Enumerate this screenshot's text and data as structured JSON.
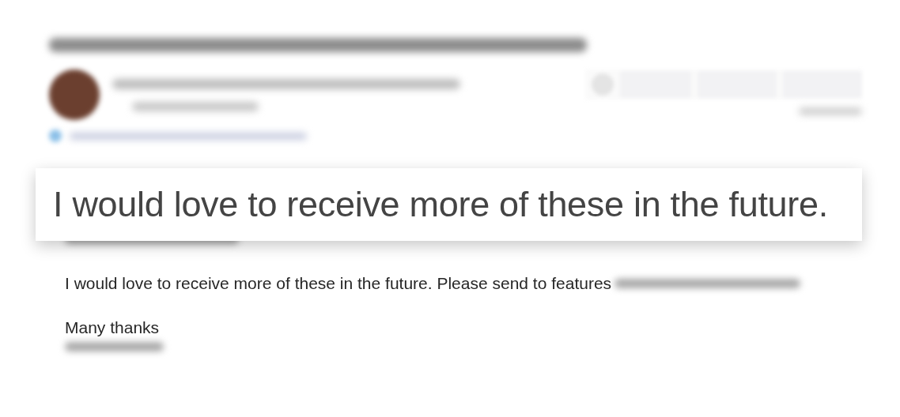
{
  "message": {
    "body_lines": [
      {
        "kind": "blurred"
      },
      {
        "kind": "text",
        "text": "I would love to receive more of these in the future. Please send to features",
        "redacted_tail": true
      },
      {
        "kind": "text",
        "text": "Many thanks",
        "redacted_tail": false
      }
    ]
  },
  "callout": {
    "text": "I would love to receive more of these in the future."
  }
}
